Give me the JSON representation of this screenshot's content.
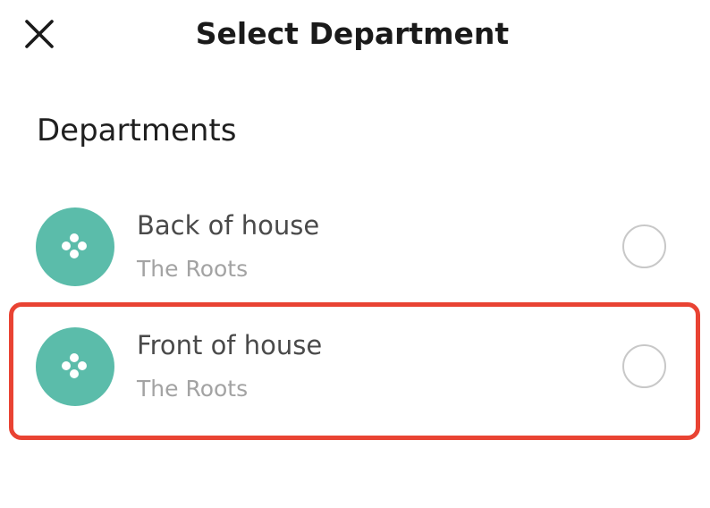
{
  "header": {
    "title": "Select Department",
    "close_icon": "close-icon"
  },
  "section": {
    "title": "Departments"
  },
  "departments": [
    {
      "name": "Back of house",
      "location": "The Roots",
      "avatar_icon": "four-dots-icon",
      "selected": false
    },
    {
      "name": "Front of house",
      "location": "The Roots",
      "avatar_icon": "four-dots-icon",
      "selected": false
    }
  ],
  "colors": {
    "avatar": "#5bbcaa",
    "highlight": "#e94333",
    "radio_border": "#c8c8c8",
    "subtitle": "#a3a3a3"
  }
}
